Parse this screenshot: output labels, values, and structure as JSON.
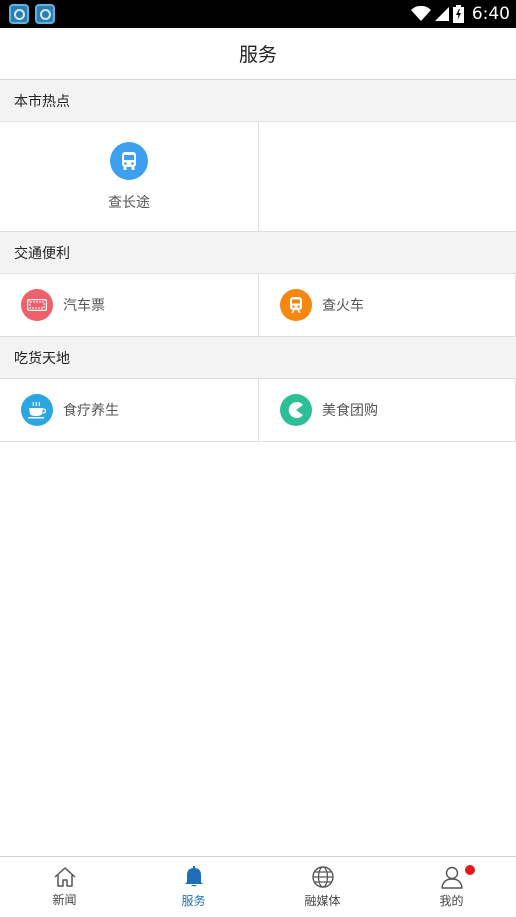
{
  "status_bar": {
    "time": "6:40"
  },
  "title": "服务",
  "sections": [
    {
      "header": "本市热点",
      "items": [
        {
          "label": "查长途",
          "icon": "bus-icon",
          "color": "#3d9ff0"
        }
      ]
    },
    {
      "header": "交通便利",
      "items": [
        {
          "label": "汽车票",
          "icon": "ticket-icon",
          "color": "#f0606a"
        },
        {
          "label": "查火车",
          "icon": "train-icon",
          "color": "#f5860f"
        }
      ]
    },
    {
      "header": "吃货天地",
      "items": [
        {
          "label": "食疗养生",
          "icon": "tea-cup-icon",
          "color": "#2ba6e0"
        },
        {
          "label": "美食团购",
          "icon": "pacman-icon",
          "color": "#2fbf98"
        }
      ]
    }
  ],
  "tabs": [
    {
      "label": "新闻",
      "icon": "home-icon",
      "active": false
    },
    {
      "label": "服务",
      "icon": "bell-icon",
      "active": true
    },
    {
      "label": "融媒体",
      "icon": "globe-icon",
      "active": false
    },
    {
      "label": "我的",
      "icon": "user-icon",
      "active": false,
      "badge": true
    }
  ],
  "colors": {
    "accent": "#1f6fb8",
    "badge": "#e41a1a"
  }
}
